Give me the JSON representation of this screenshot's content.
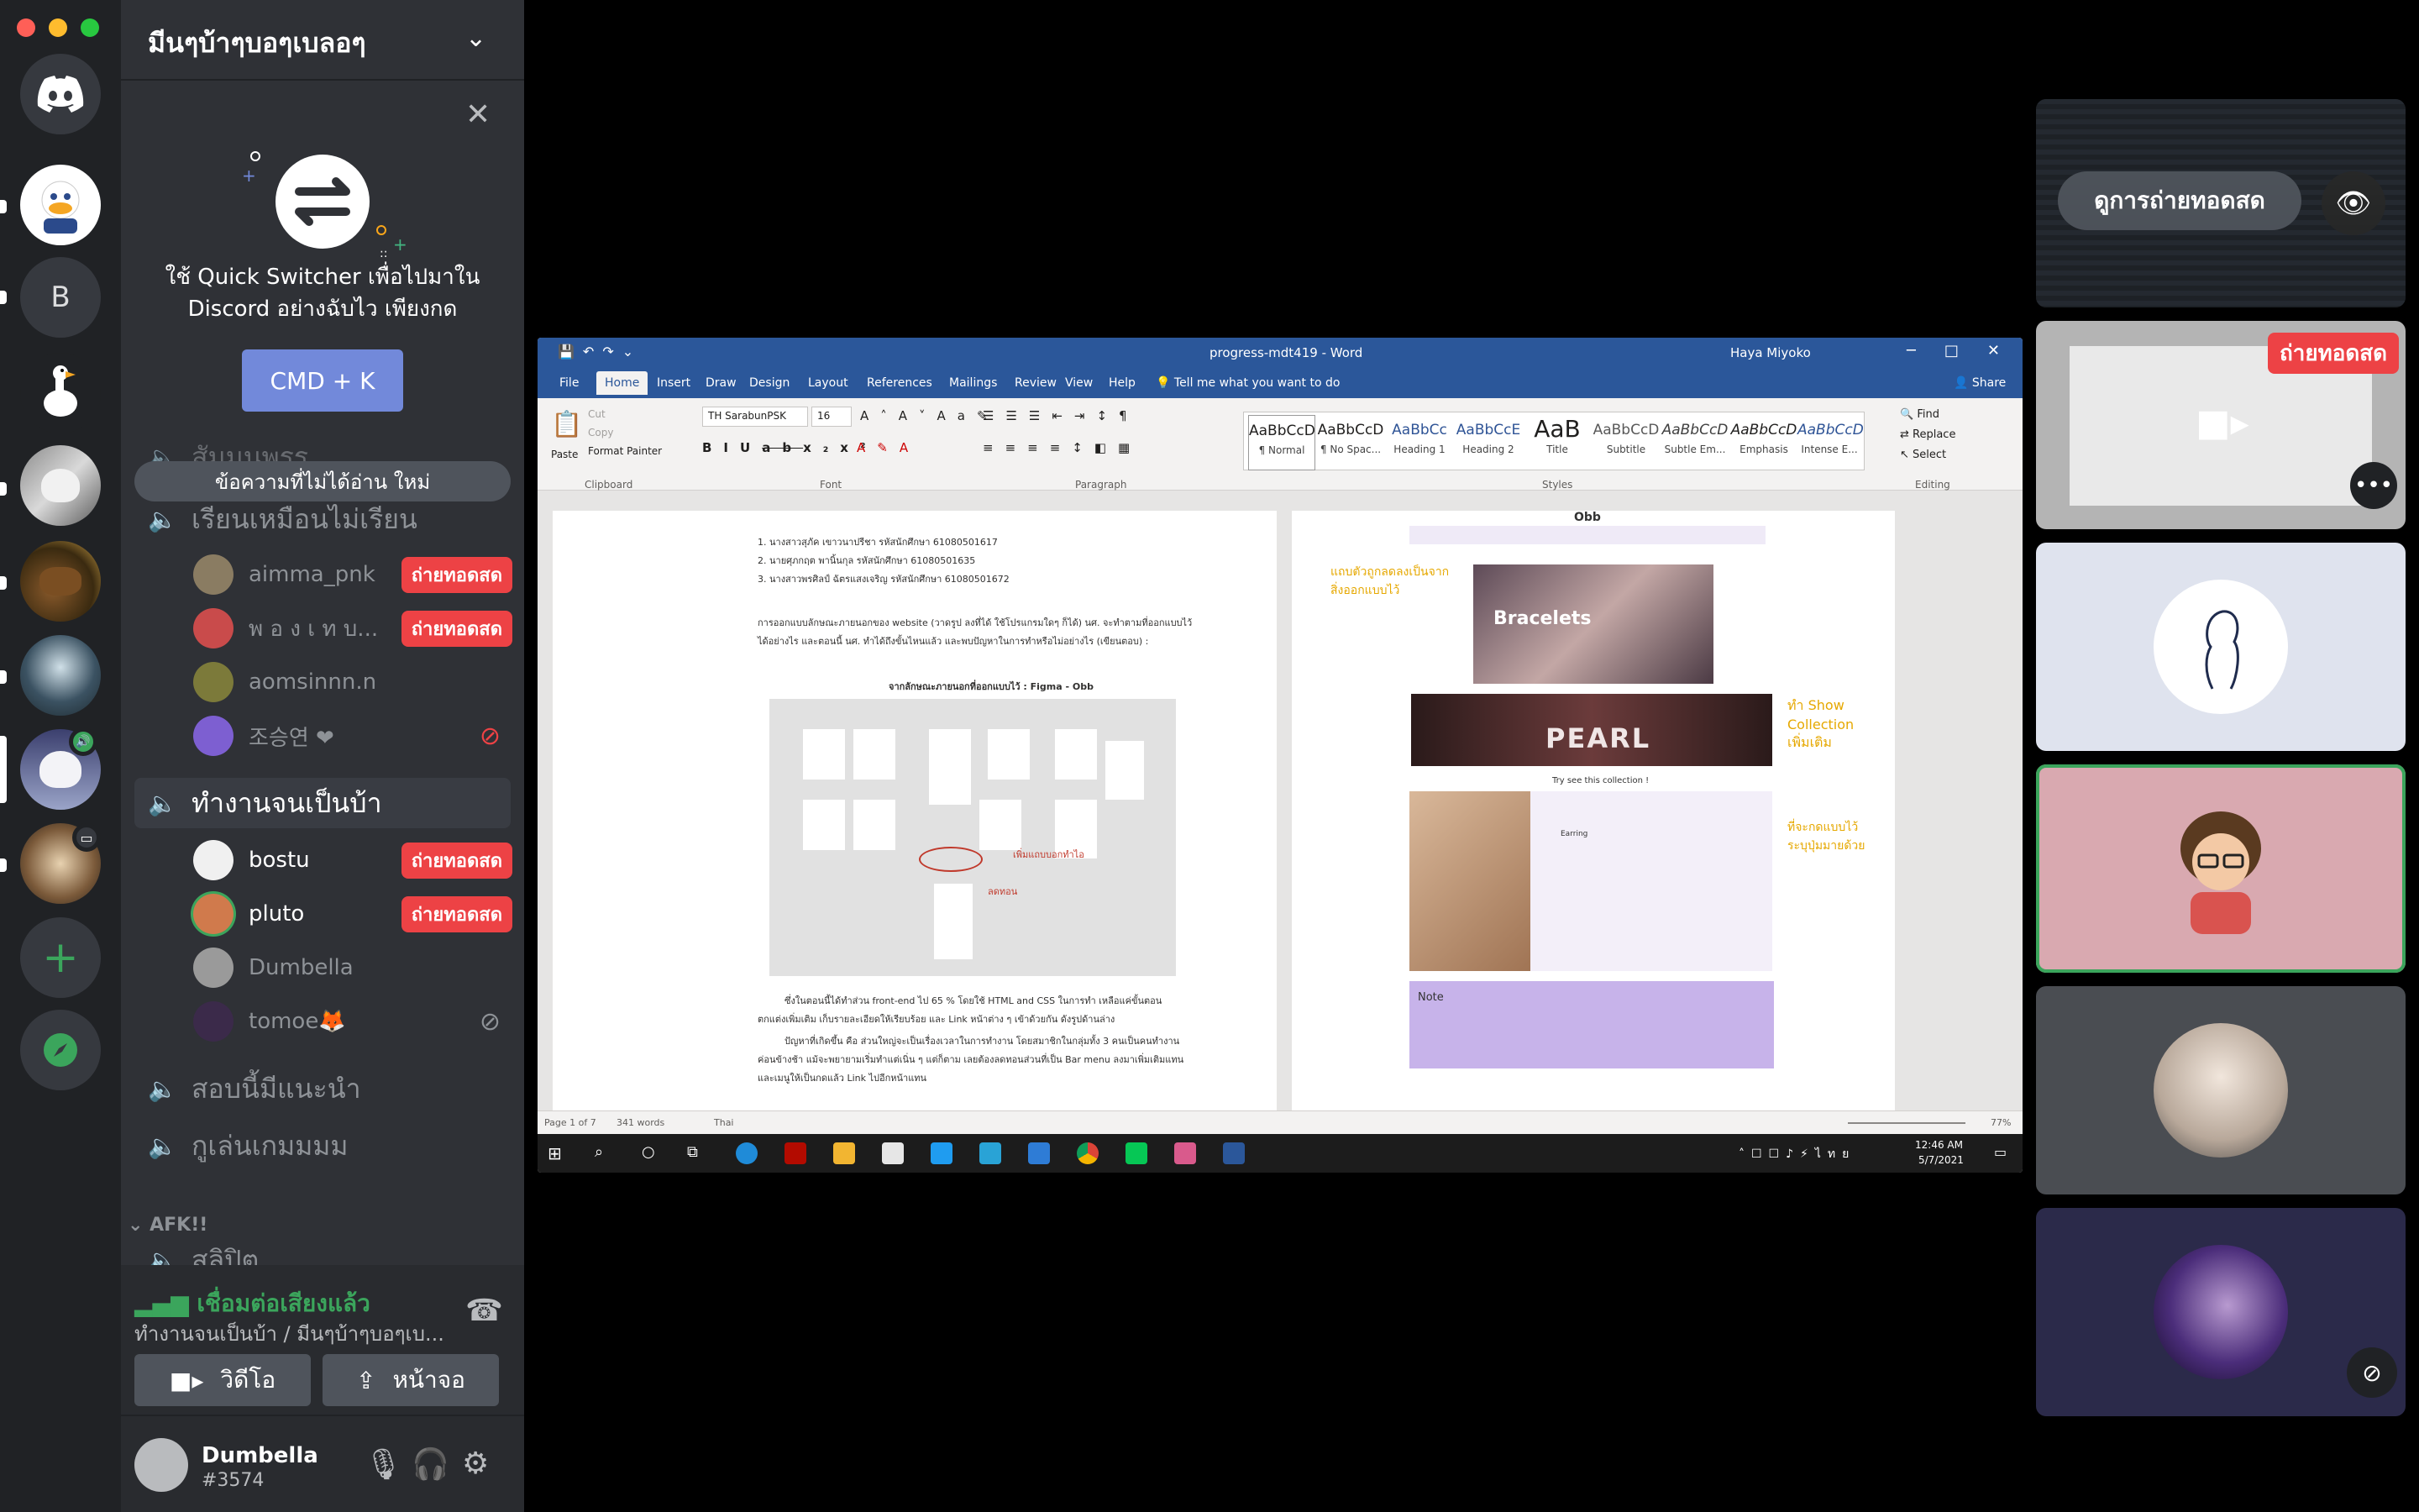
{
  "server_rail": {
    "items": [
      {
        "name": "discord-home",
        "glyph": "◕"
      },
      {
        "name": "server-duck",
        "glyph": "🐥"
      },
      {
        "name": "server-b",
        "glyph": "B"
      },
      {
        "name": "server-goose",
        "glyph": "🦢"
      },
      {
        "name": "server-cat",
        "glyph": ""
      },
      {
        "name": "server-capybara",
        "glyph": ""
      },
      {
        "name": "server-forest",
        "glyph": ""
      },
      {
        "name": "server-current",
        "glyph": ""
      },
      {
        "name": "server-food",
        "glyph": ""
      }
    ],
    "add_glyph": "+",
    "explore_glyph": "✦"
  },
  "sidebar": {
    "guild_name": "มีนๆบ้าๆบอๆเบลอๆ",
    "quick_switcher": {
      "text": "ใช้ Quick Switcher เพื่อไปมาใน Discord อย่างฉับไว เพียงกด",
      "button": "CMD + K"
    },
    "unread_pill": "ข้อความที่ไม่ได้อ่าน ใหม่",
    "partial_top_channel": "สัมมนพรร",
    "channels": [
      {
        "name": "เรียนเหมือนไม่เรียน",
        "active": false,
        "users": [
          {
            "name": "aimma_pnk",
            "live": "ถ่ายทอดสด",
            "icon": ""
          },
          {
            "name": "พ อ ง เ ท บ...",
            "live": "ถ่ายทอดสด",
            "icon": ""
          },
          {
            "name": "aomsinnn.n",
            "live": "",
            "icon": ""
          },
          {
            "name": "조승연 ❤",
            "live": "",
            "icon": "🎙"
          }
        ]
      },
      {
        "name": "ทำงานจนเป็นบ้า",
        "active": true,
        "users": [
          {
            "name": "bostu",
            "live": "ถ่ายทอดสด",
            "icon": ""
          },
          {
            "name": "pluto",
            "live": "ถ่ายทอดสด",
            "icon": ""
          },
          {
            "name": "Dumbella",
            "live": "",
            "icon": ""
          },
          {
            "name": "tomoe🦊",
            "live": "",
            "icon": "🎙"
          }
        ]
      },
      {
        "name": "สอบนี้มีแนะนำ",
        "active": false,
        "users": []
      },
      {
        "name": "กูเล่นเกมมมม",
        "active": false,
        "users": []
      }
    ],
    "category_afk": "AFK!!",
    "partial_bottom_channel": "สลิปิต"
  },
  "voice_panel": {
    "status": "เชื่อมต่อเสียงแล้ว",
    "location": "ทำงานจนเป็นบ้า / มีนๆบ้าๆบอๆเบ...",
    "video_label": "วิดีโอ",
    "screen_label": "หน้าจอ"
  },
  "user_panel": {
    "name": "Dumbella",
    "tag": "#3574"
  },
  "word": {
    "title": "progress-mdt419 - Word",
    "user": "Haya Miyoko",
    "tabs": [
      "File",
      "Home",
      "Insert",
      "Draw",
      "Design",
      "Layout",
      "References",
      "Mailings",
      "Review",
      "View",
      "Help",
      "Tell me what you want to do"
    ],
    "share": "Share",
    "clipboard": {
      "paste": "Paste",
      "cut": "Cut",
      "copy": "Copy",
      "painter": "Format Painter",
      "group": "Clipboard"
    },
    "font": {
      "name": "TH SarabunPSK",
      "size": "16",
      "group": "Font"
    },
    "paragraph_group": "Paragraph",
    "styles": [
      {
        "preview": "AaBbCcD",
        "name": "¶ Normal"
      },
      {
        "preview": "AaBbCcD",
        "name": "¶ No Spac..."
      },
      {
        "preview": "AaBbCc",
        "name": "Heading 1"
      },
      {
        "preview": "AaBbCcE",
        "name": "Heading 2"
      },
      {
        "preview": "AaB",
        "name": "Title"
      },
      {
        "preview": "AaBbCcD",
        "name": "Subtitle"
      },
      {
        "preview": "AaBbCcD",
        "name": "Subtle Em..."
      },
      {
        "preview": "AaBbCcD",
        "name": "Emphasis"
      },
      {
        "preview": "AaBbCcD",
        "name": "Intense E..."
      }
    ],
    "styles_group": "Styles",
    "editing": {
      "find": "Find",
      "replace": "Replace",
      "select": "Select",
      "group": "Editing"
    },
    "doc_lines": [
      "1.      นางสาวสุภัค เขาวนาปรีชา                      รหัสนักศึกษา    61080501617",
      "2.      นายศุภกฤต พานิ้นกุล                              รหัสนักศึกษา    61080501635",
      "3.      นางสาวพรศิลป์ ฉัตรแสงเจริญ                  รหัสนักศึกษา    61080501672",
      "การออกแบบลักษณะภายนอกของ website (วาดรูป ลงที่ได้ ใช้โปรแกรมใดๆ ก็ได้)  นศ. จะทำตามที่ออกแบบไว้",
      "ได้อย่างไร และตอนนี้ นศ. ทำได้ถึงขั้นไหนแล้ว และพบปัญหาในการทำหรือไม่อย่างไร (เขียนตอบ) :",
      "จากลักษณะภายนอกที่ออกแบบไว้ : Figma - Obb",
      "ซึ่งในตอนนี้ได้ทำส่วน front-end ไป 65 % โดยใช้ HTML and CSS ในการทำ เหลือแค่ขั้นตอน",
      "ตกแต่งเพิ่มเติม เก็บรายละเอียดให้เรียบร้อย และ Link หน้าต่าง ๆ เข้าด้วยกัน ดังรูปด้านล่าง",
      "ปัญหาที่เกิดขึ้น คือ ส่วนใหญ่จะเป็นเรื่องเวลาในการทำงาน โดยสมาชิกในกลุ่มทั้ง 3 คนเป็นคนทำงาน",
      "ค่อนข้างช้า แม้จะพยายามเริ่มทำแต่เนิ่น ๆ แต่ก็ตาม เลยต้องลดทอนส่วนที่เป็น Bar menu ลงมาเพิ่มเติมแทน",
      "และเมนูให้เป็นกดแล้ว Link ไปอีกหน้าแทน"
    ],
    "preview": {
      "brand": "Obb",
      "bracelets": "Bracelets",
      "pearl": "PEARL",
      "try_text": "Try see this collection !",
      "earring": "Earring",
      "note": "Note",
      "annot1": "แถบตัวถูกลดลงเป็นจากสิ่งออกแบบไว้",
      "annot2": "ทำ Show Collection เพิ่มเติม",
      "annot3": "ที่จะกดแบบไว้ ระบุปุ่มมายด้วย",
      "annot4": "เพิ่มแถบบอกทำไอ",
      "annot5": "ลดทอน"
    },
    "status": {
      "page": "Page 1 of 7",
      "words": "341 words",
      "lang": "Thai",
      "zoom": "77%"
    },
    "clock": {
      "time": "12:46 AM",
      "date": "5/7/2021"
    }
  },
  "tiles": {
    "watch_label": "ดูการถ่ายทอดสด",
    "live_badge": "ถ่ายทอดสด"
  },
  "colors": {
    "blurple": "#7289da",
    "live_red": "#ed4245",
    "online_green": "#3ba55c",
    "word_blue": "#2b579a"
  }
}
